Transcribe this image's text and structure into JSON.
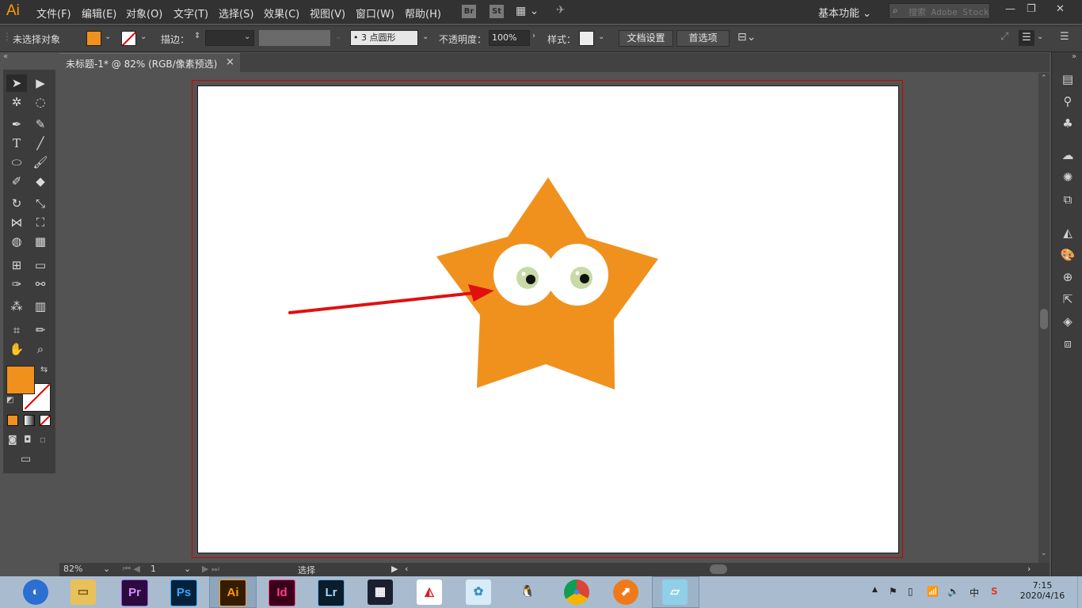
{
  "app": {
    "logo": "Ai"
  },
  "menu": [
    "文件(F)",
    "编辑(E)",
    "对象(O)",
    "文字(T)",
    "选择(S)",
    "效果(C)",
    "视图(V)",
    "窗口(W)",
    "帮助(H)"
  ],
  "menubar_icons": {
    "bridge": "Br",
    "stock": "St"
  },
  "workspace": "基本功能",
  "search": {
    "placeholder": "搜索 Adobe Stock"
  },
  "control": {
    "selection": "未选择对象",
    "stroke_label": "描边：",
    "brush": "3 点圆形",
    "opacity_label": "不透明度：",
    "opacity": "100%",
    "style_label": "样式：",
    "doc_setup": "文档设置",
    "preferences": "首选项"
  },
  "document": {
    "tab_title": "未标题-1* @ 82% (RGB/像素预选)",
    "close": "×"
  },
  "status": {
    "zoom": "82%",
    "artboard": "1",
    "tool": "选择"
  },
  "colors": {
    "fill": "#f0911e",
    "star": "#f0911e",
    "eye_white": "#ffffff",
    "iris": "#c9d9a8",
    "arrow": "#e01010",
    "bleed": "#d00000"
  },
  "taskbar": {
    "apps": [
      "Pr",
      "Ps",
      "Ai",
      "Id",
      "Lr"
    ],
    "time": "7:15",
    "date": "2020/4/16",
    "ime": "中"
  }
}
